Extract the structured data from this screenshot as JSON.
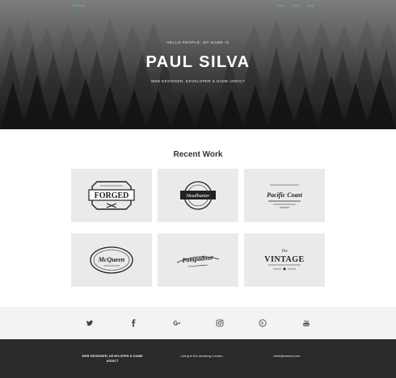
{
  "header": {
    "brand": "Portfolio",
    "nav": [
      {
        "label": "Home"
      },
      {
        "label": "Work"
      },
      {
        "label": "Blog"
      }
    ]
  },
  "hero": {
    "greeting": "HELLO PEOPLE, MY NAME IS",
    "name": "PAUL SILVA",
    "tagline": "WEB DESIGNER, DEVELOPER & GAME ADDICT"
  },
  "recent_work": {
    "title": "Recent Work",
    "items": [
      {
        "logo_text": "FORGED"
      },
      {
        "logo_text": "Headhunter"
      },
      {
        "logo_text": "Pacific Coast"
      },
      {
        "logo_text": "McQueen"
      },
      {
        "logo_text": "Pompadour"
      },
      {
        "logo_text": "VINTAGE"
      }
    ]
  },
  "social": {
    "icons": [
      "twitter-icon",
      "facebook-icon",
      "google-plus-icon",
      "instagram-icon",
      "pinterest-icon",
      "youtube-icon"
    ]
  },
  "footer": {
    "about": "WEB DESIGNER, DEVELOPER & GAME ADDICT",
    "location": "Living in the amazing London.",
    "email": "hello@instant.com"
  },
  "colors": {
    "accent": "#3fd1b5",
    "footer_bg": "#2a2a2a",
    "social_bg": "#f3f3f3",
    "tile_bg": "#eaeaea"
  }
}
